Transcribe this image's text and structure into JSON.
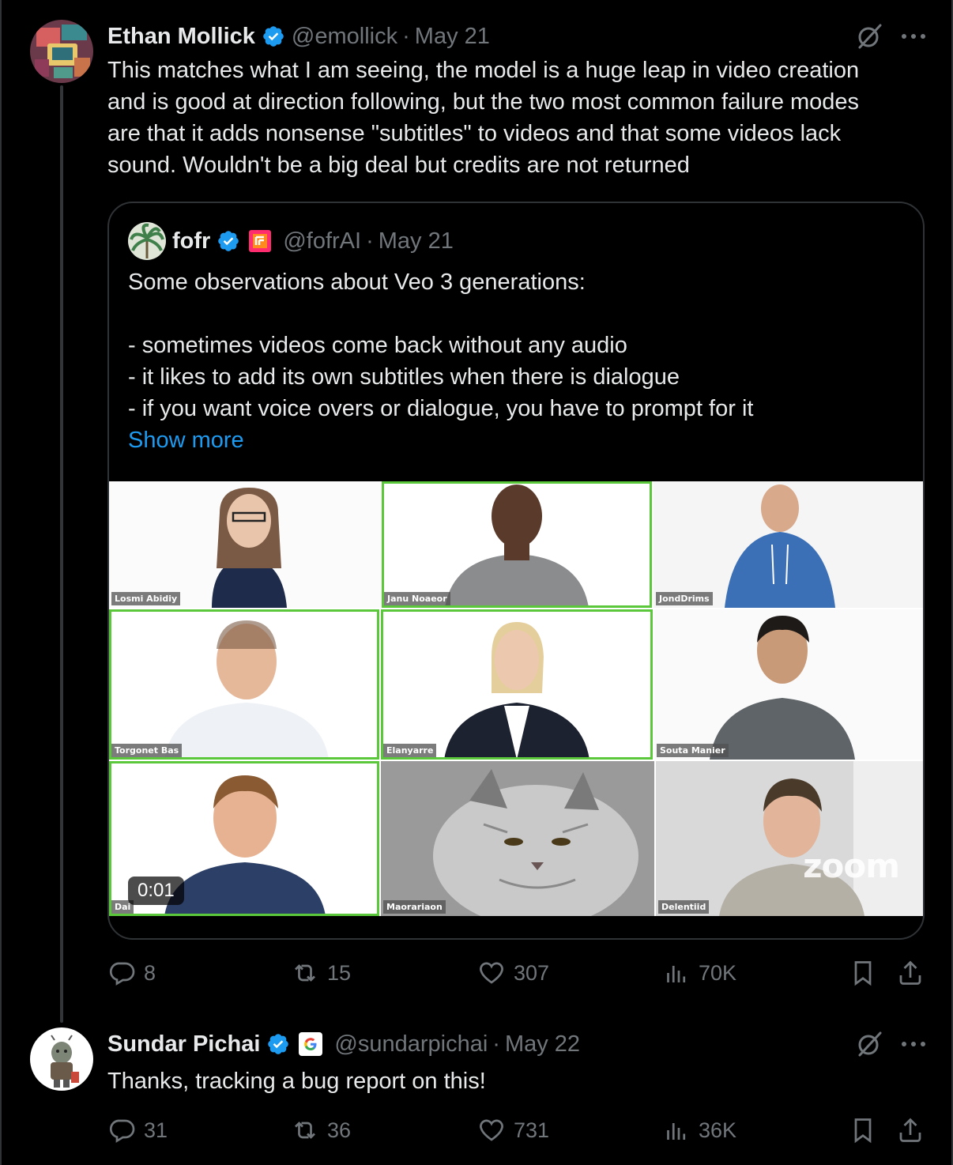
{
  "tweet1": {
    "name": "Ethan Mollick",
    "handle": "@emollick",
    "separator": "·",
    "date": "May 21",
    "text": "This matches what I am seeing, the model is a huge leap in video creation\nand is good at direction following, but the two most common failure modes\nare that it adds nonsense \"subtitles\" to videos and that some videos lack\nsound. Wouldn't be a big deal but credits are not returned",
    "quote": {
      "name": "fofr",
      "handle": "@fofrAI",
      "separator": "·",
      "date": "May 21",
      "text": "Some observations about Veo 3 generations:\n\n- sometimes videos come back without any audio\n- it likes to add its own subtitles when there is dialogue\n- if you want voice overs or dialogue, you have to prompt for it",
      "show_more": "Show more",
      "video": {
        "timestamp": "0:01",
        "watermark": "zoom",
        "tiles": [
          "Losmi Abidiy",
          "Janu Noaeor",
          "JondDrims",
          "Torgonet Bas",
          "Elanyarre",
          "Souta Manier",
          "Dai",
          "Maorariaon",
          "Delentiid"
        ]
      }
    },
    "stats": {
      "replies": "8",
      "reposts": "15",
      "likes": "307",
      "views": "70K"
    }
  },
  "tweet2": {
    "name": "Sundar Pichai",
    "handle": "@sundarpichai",
    "separator": "·",
    "date": "May 22",
    "text": "Thanks, tracking a bug report on this!",
    "stats": {
      "replies": "31",
      "reposts": "36",
      "likes": "731",
      "views": "36K"
    }
  },
  "colors": {
    "background": "#000000",
    "text": "#e7e9ea",
    "muted": "#71767b",
    "link": "#1d9bf0",
    "verified": "#1d9bf0",
    "border": "#2f3336",
    "active_speaker": "#5ac83a"
  },
  "icons": [
    "verified-badge-icon",
    "grok-icon",
    "more-icon",
    "reply-icon",
    "repost-icon",
    "like-icon",
    "views-icon",
    "bookmark-icon",
    "share-icon",
    "google-affiliate-icon",
    "fofr-affiliate-icon"
  ]
}
